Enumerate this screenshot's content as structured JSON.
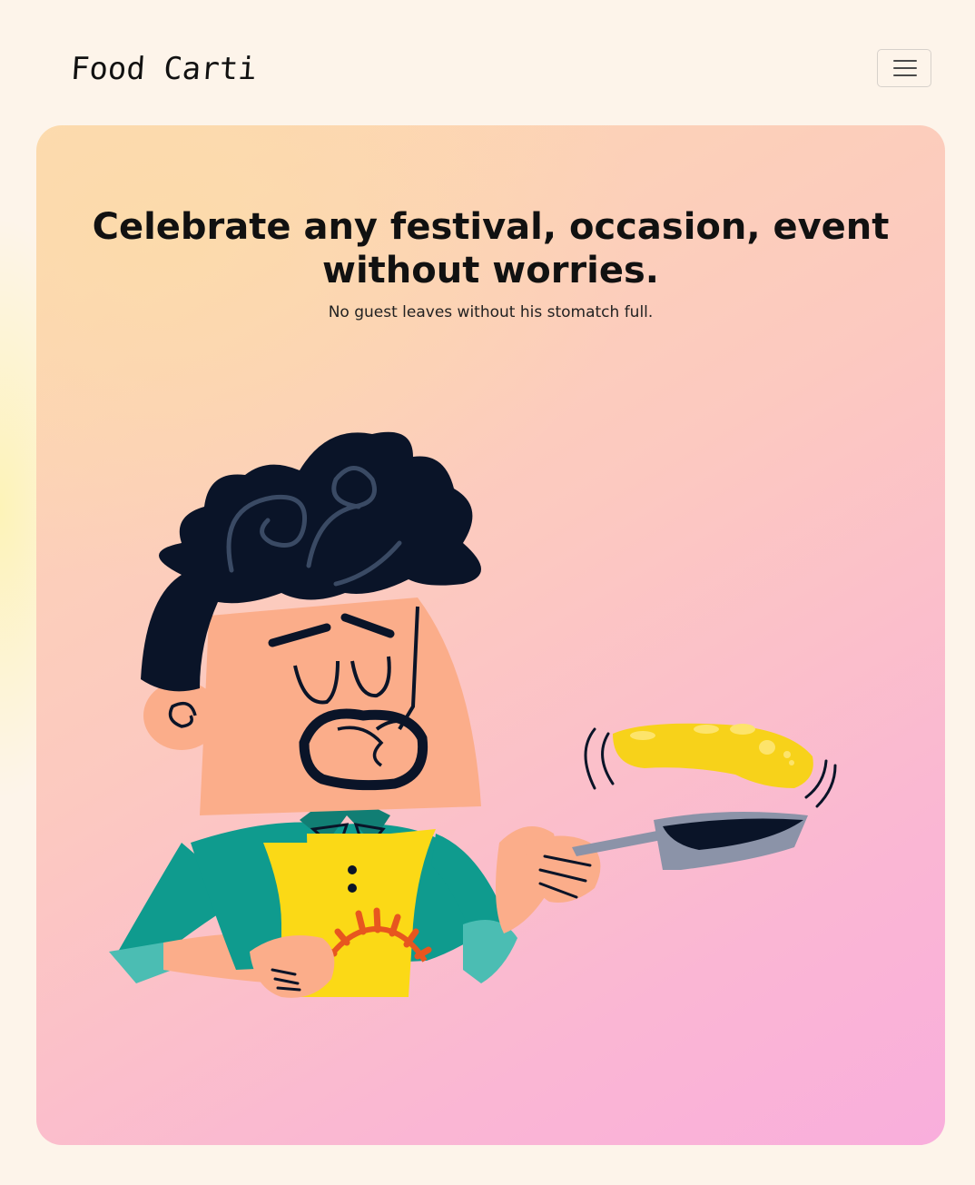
{
  "navbar": {
    "brand": "Food Carti",
    "menu_icon": "hamburger-menu-icon"
  },
  "hero": {
    "title": "Celebrate any festival, occasion, event without worries.",
    "subtitle": "No guest leaves without his stomatch full.",
    "illustration": "chef-flipping-pancake-illustration"
  },
  "colors": {
    "page_background": "#fdf4ea",
    "hero_gradient_start": "#fdd9b0",
    "hero_gradient_end": "#f9aedc",
    "text": "#111111"
  }
}
